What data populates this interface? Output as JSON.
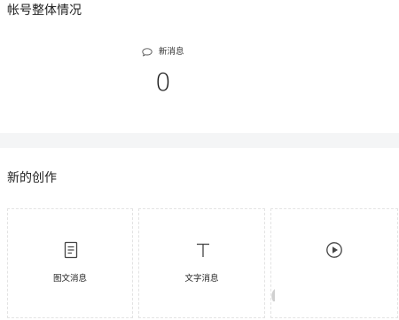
{
  "overview": {
    "title": "帐号整体情况",
    "new_messages": {
      "label": "新消息",
      "value": "0",
      "icon": "chat-bubble-icon"
    }
  },
  "creation": {
    "title": "新的创作",
    "cards": [
      {
        "label": "图文消息",
        "icon": "document-icon"
      },
      {
        "label": "文字消息",
        "icon": "text-t-icon"
      },
      {
        "label": "",
        "icon": "play-circle-icon"
      }
    ]
  },
  "colors": {
    "background": "#ffffff",
    "divider_band": "#f4f5f6",
    "card_border": "#e3e3e3",
    "text": "#222222",
    "icon": "#444444"
  }
}
